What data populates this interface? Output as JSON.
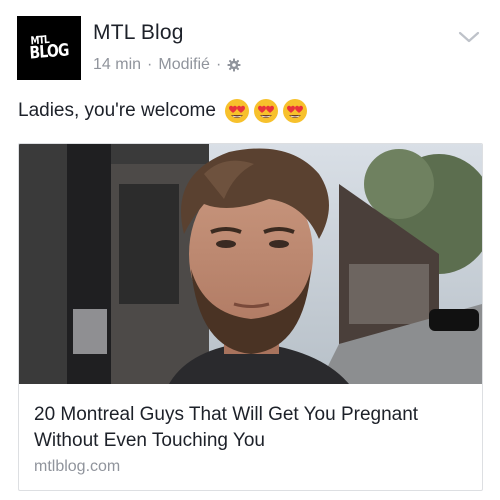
{
  "header": {
    "page_name": "MTL Blog",
    "time": "14 min",
    "separator": "·",
    "edited": "Modifié",
    "separator2": "·",
    "privacy_icon": "gear-icon",
    "menu_icon": "chevron-down-icon"
  },
  "avatar": {
    "logo_line1": "MTL",
    "logo_line2": "BLOG"
  },
  "post": {
    "text": "Ladies, you're welcome",
    "emoji": [
      "heart-eyes-emoji",
      "heart-eyes-emoji",
      "heart-eyes-emoji"
    ]
  },
  "link": {
    "title": "20 Montreal Guys That Will Get You Pregnant Without Even Touching You",
    "domain": "mtlblog.com"
  },
  "colors": {
    "text_primary": "#1d2129",
    "text_secondary": "#90949c",
    "border": "#dddfe2",
    "emoji_face": "#f7c12c",
    "emoji_heart": "#e8333b"
  }
}
